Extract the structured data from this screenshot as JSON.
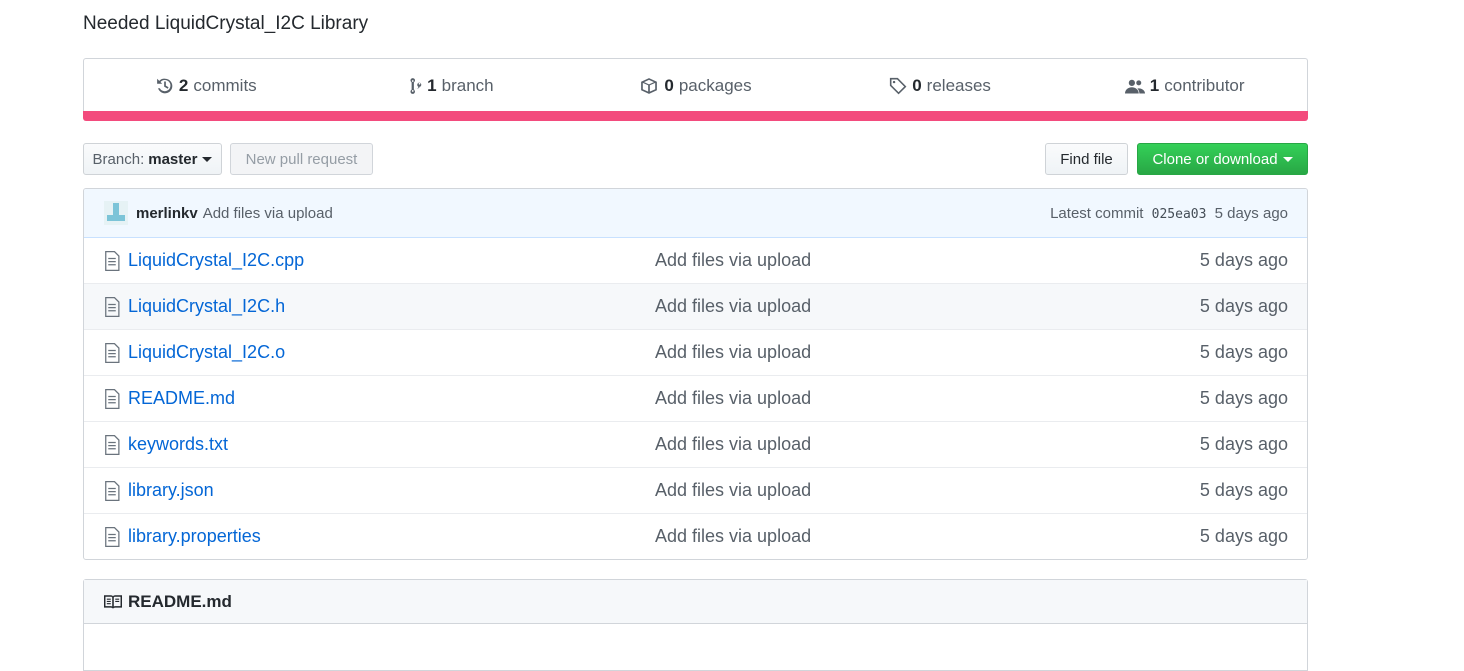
{
  "repo": {
    "description": "Needed LiquidCrystal_I2C Library"
  },
  "summary": [
    {
      "icon": "history-icon",
      "count": "2",
      "label": "commits"
    },
    {
      "icon": "git-branch-icon",
      "count": "1",
      "label": "branch"
    },
    {
      "icon": "package-icon",
      "count": "0",
      "label": "packages"
    },
    {
      "icon": "tag-icon",
      "count": "0",
      "label": "releases"
    },
    {
      "icon": "people-icon",
      "count": "1",
      "label": "contributor"
    }
  ],
  "language_bar": {
    "color": "#f34b7d"
  },
  "toolbar": {
    "branch_prefix": "Branch:",
    "branch_name": "master",
    "new_pr": "New pull request",
    "find_file": "Find file",
    "clone": "Clone or download"
  },
  "latest_commit": {
    "author": "merlinkv",
    "message": "Add files via upload",
    "prefix": "Latest commit",
    "sha": "025ea03",
    "age": "5 days ago"
  },
  "files": [
    {
      "name": "LiquidCrystal_I2C.cpp",
      "message": "Add files via upload",
      "age": "5 days ago"
    },
    {
      "name": "LiquidCrystal_I2C.h",
      "message": "Add files via upload",
      "age": "5 days ago"
    },
    {
      "name": "LiquidCrystal_I2C.o",
      "message": "Add files via upload",
      "age": "5 days ago"
    },
    {
      "name": "README.md",
      "message": "Add files via upload",
      "age": "5 days ago"
    },
    {
      "name": "keywords.txt",
      "message": "Add files via upload",
      "age": "5 days ago"
    },
    {
      "name": "library.json",
      "message": "Add files via upload",
      "age": "5 days ago"
    },
    {
      "name": "library.properties",
      "message": "Add files via upload",
      "age": "5 days ago"
    }
  ],
  "readme": {
    "title": "README.md"
  },
  "colors": {
    "link": "#0366d6",
    "clone_button": "#28a745",
    "commit_tease_bg": "#f1f8ff"
  }
}
